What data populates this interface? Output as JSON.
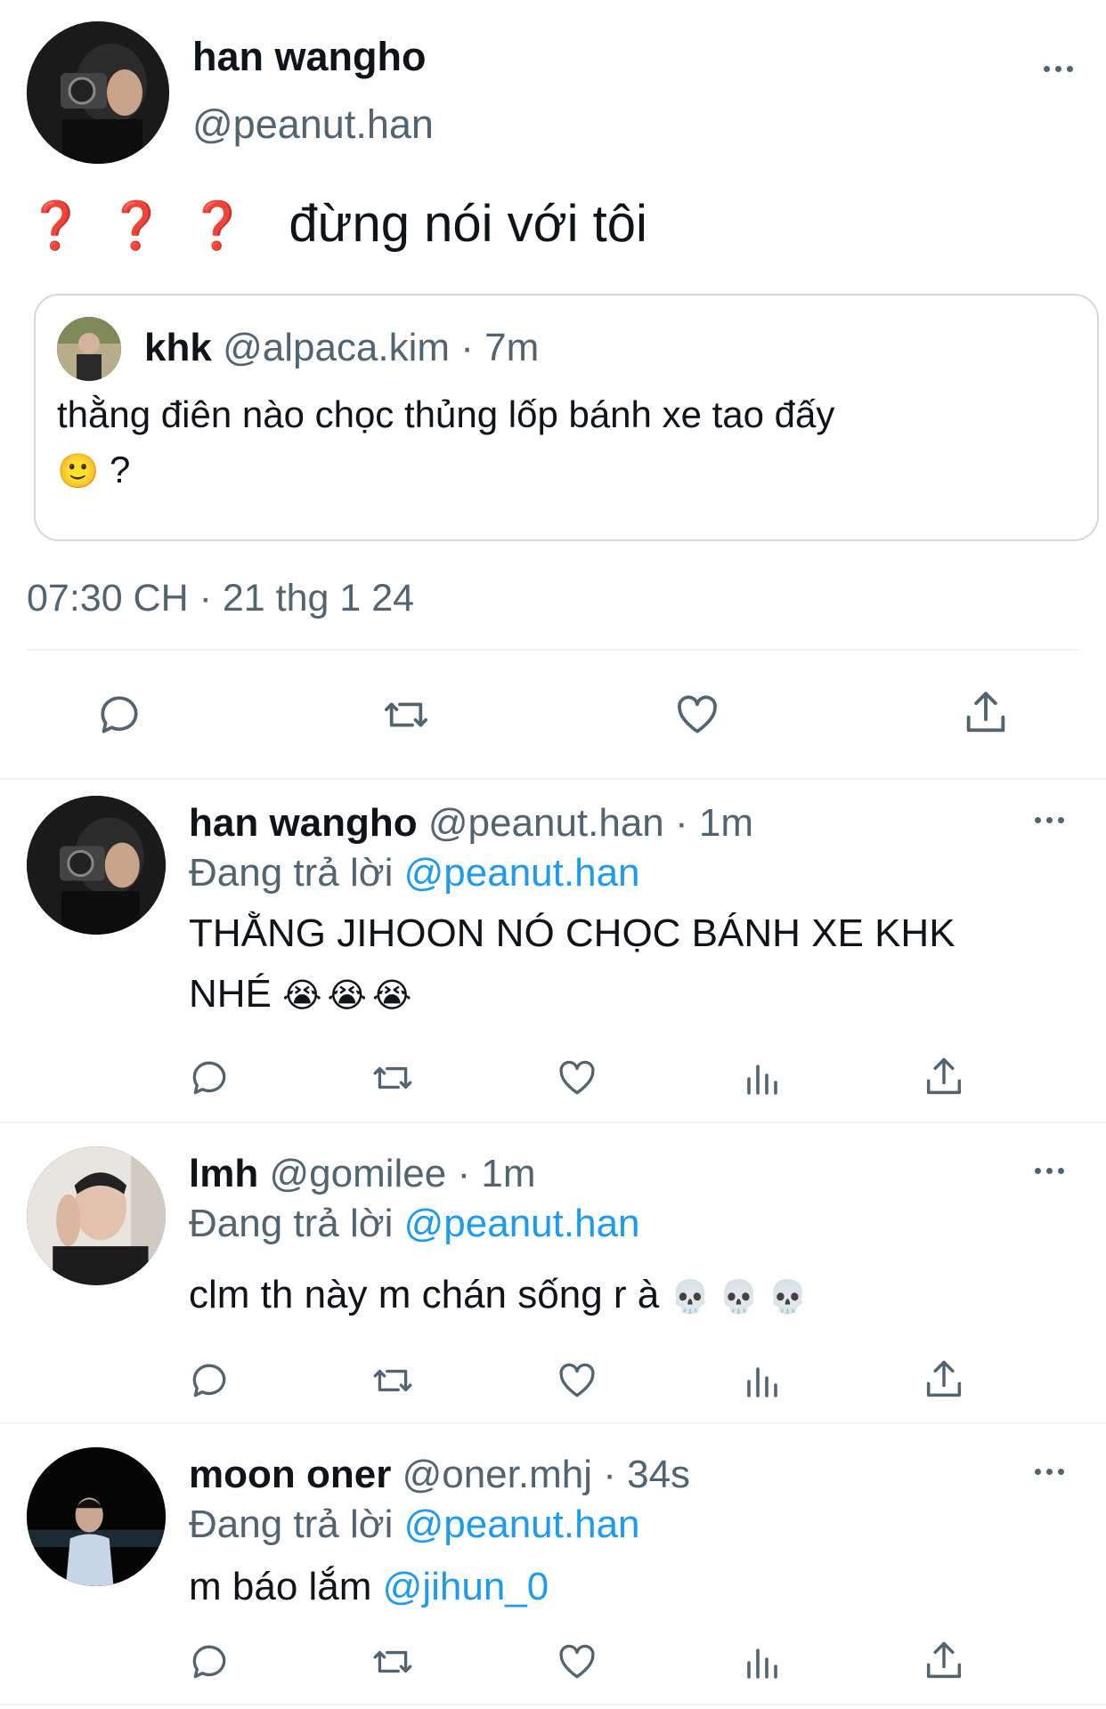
{
  "main_tweet": {
    "author_name": "han wangho",
    "author_handle": "@peanut.han",
    "text_emoji": "❓❓❓",
    "text": "đừng nói với tôi",
    "quoted": {
      "author_name": "khk",
      "author_handle": "@alpaca.kim",
      "time": "· 7m",
      "text_line1": "thằng điên nào chọc thủng lốp bánh xe tao đấy",
      "text_line2_emoji": "🙂",
      "text_line2": "?"
    },
    "timestamp": "07:30 CH · 21 thg 1 24"
  },
  "replies": [
    {
      "author_name": "han wangho",
      "author_handle": "@peanut.han",
      "time": "· 1m",
      "replying_label": "Đang trả lời",
      "replying_to": "@peanut.han",
      "text_line1": "THẰNG JIHOON NÓ CHỌC BÁNH XE KHK",
      "text_line2": "NHÉ",
      "text_emoji": "😭😭😭"
    },
    {
      "author_name": "lmh",
      "author_handle": "@gomilee",
      "time": "· 1m",
      "replying_label": "Đang trả lời",
      "replying_to": "@peanut.han",
      "text_line1": "clm th này m chán sống r à",
      "text_emoji": "💀💀💀"
    },
    {
      "author_name": "moon oner",
      "author_handle": "@oner.mhj",
      "time": "· 34s",
      "replying_label": "Đang trả lời",
      "replying_to": "@peanut.han",
      "text_line1": "m báo lắm",
      "mention": "@jihun_0"
    }
  ],
  "icons": [
    "reply-icon",
    "retweet-icon",
    "like-icon",
    "views-icon",
    "share-icon",
    "more-icon"
  ],
  "colors": {
    "link": "#1d9bf0",
    "secondary": "#536471",
    "text": "#0f1419",
    "divider": "#eff3f4"
  }
}
